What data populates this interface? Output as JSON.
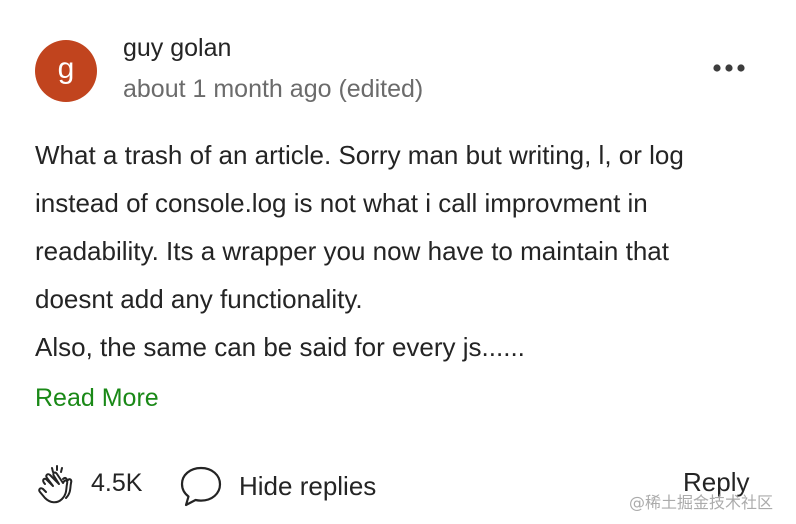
{
  "comment": {
    "avatar_initial": "g",
    "avatar_color": "#c1441e",
    "author": "guy golan",
    "timestamp": "about 1 month ago (edited)",
    "more_icon": "more-horizontal-icon",
    "body_lines": [
      "What a trash of an article. Sorry man but writing, l, or log",
      "instead of console.log is not what i call improvment in",
      "readability. Its a wrapper you now have to maintain that",
      "doesnt add any functionality.",
      "Also, the same can be said for every js......"
    ],
    "read_more_label": "Read More",
    "read_more_color": "#1a8917"
  },
  "actions": {
    "clap_icon": "clap-icon",
    "clap_count": "4.5K",
    "reply_icon": "speech-bubble-icon",
    "hide_replies_label": "Hide replies",
    "reply_label": "Reply"
  },
  "watermark": "@稀土掘金技术社区"
}
